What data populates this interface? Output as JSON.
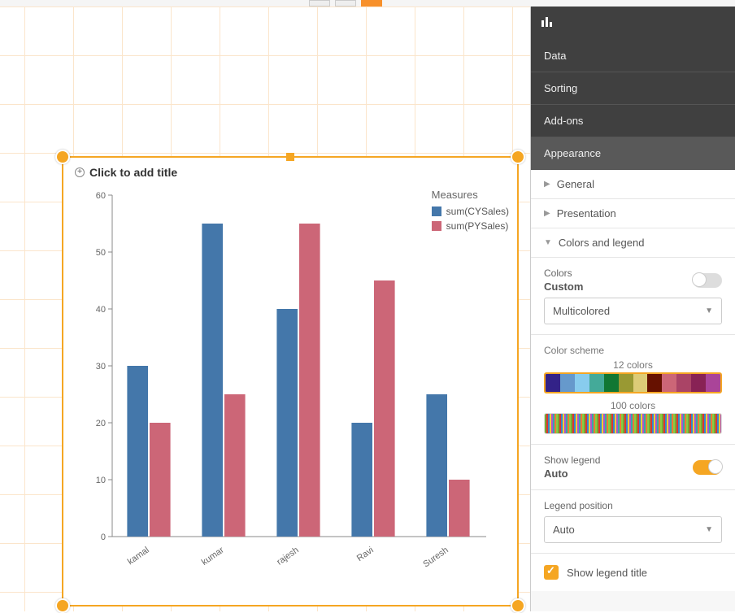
{
  "chart_data": {
    "type": "bar",
    "title_placeholder": "Click to add title",
    "legend_title": "Measures",
    "ylim": [
      0,
      60
    ],
    "yticks": [
      0,
      10,
      20,
      30,
      40,
      50,
      60
    ],
    "categories": [
      "kamal",
      "kumar",
      "rajesh",
      "Ravi",
      "Suresh"
    ],
    "series": [
      {
        "name": "sum(CYSales)",
        "color": "#4477aa",
        "values": [
          30,
          55,
          40,
          20,
          25
        ]
      },
      {
        "name": "sum(PYSales)",
        "color": "#cc6677",
        "values": [
          20,
          25,
          55,
          45,
          10
        ]
      }
    ]
  },
  "panel": {
    "sections": {
      "data": "Data",
      "sorting": "Sorting",
      "addons": "Add-ons",
      "appearance": "Appearance"
    },
    "appearance": {
      "general": "General",
      "presentation": "Presentation",
      "colors_legend": "Colors and legend"
    },
    "colors": {
      "label": "Colors",
      "value": "Custom",
      "dropdown": "Multicolored",
      "scheme_label": "Color scheme",
      "scheme_12": "12 colors",
      "scheme_100": "100 colors",
      "palette_12": [
        "#332288",
        "#6699cc",
        "#88ccee",
        "#44aa99",
        "#117733",
        "#999933",
        "#ddcc77",
        "#661100",
        "#cc6677",
        "#aa4466",
        "#882255",
        "#aa4499"
      ]
    },
    "legend": {
      "show_label": "Show legend",
      "show_value": "Auto",
      "position_label": "Legend position",
      "position_value": "Auto",
      "show_title": "Show legend title"
    }
  }
}
